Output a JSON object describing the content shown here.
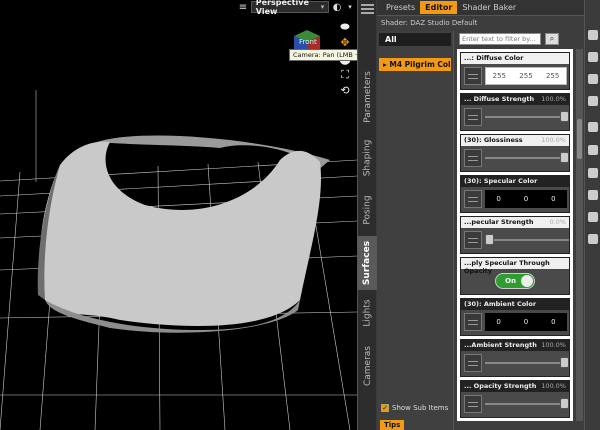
{
  "viewport": {
    "view_name": "Perspective View",
    "cube_label": "Front",
    "tooltip": "Camera: Pan (LMB + Drag) | Dolly (RMB + Drag)"
  },
  "side_tabs": [
    "Parameters",
    "Shaping",
    "Posing",
    "Surfaces",
    "Lights",
    "Cameras"
  ],
  "active_side_tab": "Surfaces",
  "surfaces": {
    "tabs": [
      "Presets",
      "Editor",
      "Shader Baker"
    ],
    "active_tab": "Editor",
    "shader": "Shader: DAZ Studio Default",
    "tree_root": "All",
    "tree_item": "M4 Pilgrim Collar",
    "filter_placeholder": "Enter text to filter by...",
    "show_sub_items": "Show Sub Items",
    "show_sub_checked": true,
    "properties": [
      {
        "title": "...: Diffuse Color",
        "kind": "color",
        "color": "white",
        "rgb": [
          "255",
          "255",
          "255"
        ]
      },
      {
        "title": "... Diffuse Strength",
        "pct": "100.0%",
        "kind": "slider",
        "level": 1.0
      },
      {
        "title": "(30): Glossiness",
        "pct": "100.0%",
        "kind": "slider",
        "level": 1.0,
        "light": true
      },
      {
        "title": "(30): Specular Color",
        "kind": "color",
        "color": "black",
        "rgb": [
          "0",
          "0",
          "0"
        ]
      },
      {
        "title": "...pecular Strength",
        "pct": "0.0%",
        "kind": "slider",
        "level": 0.0,
        "light": true
      },
      {
        "title": "...ply Specular Through Opacity",
        "kind": "toggle",
        "value": "On",
        "light": true
      },
      {
        "title": "(30): Ambient Color",
        "kind": "color",
        "color": "black",
        "rgb": [
          "0",
          "0",
          "0"
        ]
      },
      {
        "title": "...Ambient Strength",
        "pct": "100.0%",
        "kind": "slider",
        "level": 1.0
      },
      {
        "title": "... Opacity Strength",
        "pct": "100.0%",
        "kind": "slider",
        "level": 1.0
      }
    ],
    "bottom_tab": "Tips"
  }
}
